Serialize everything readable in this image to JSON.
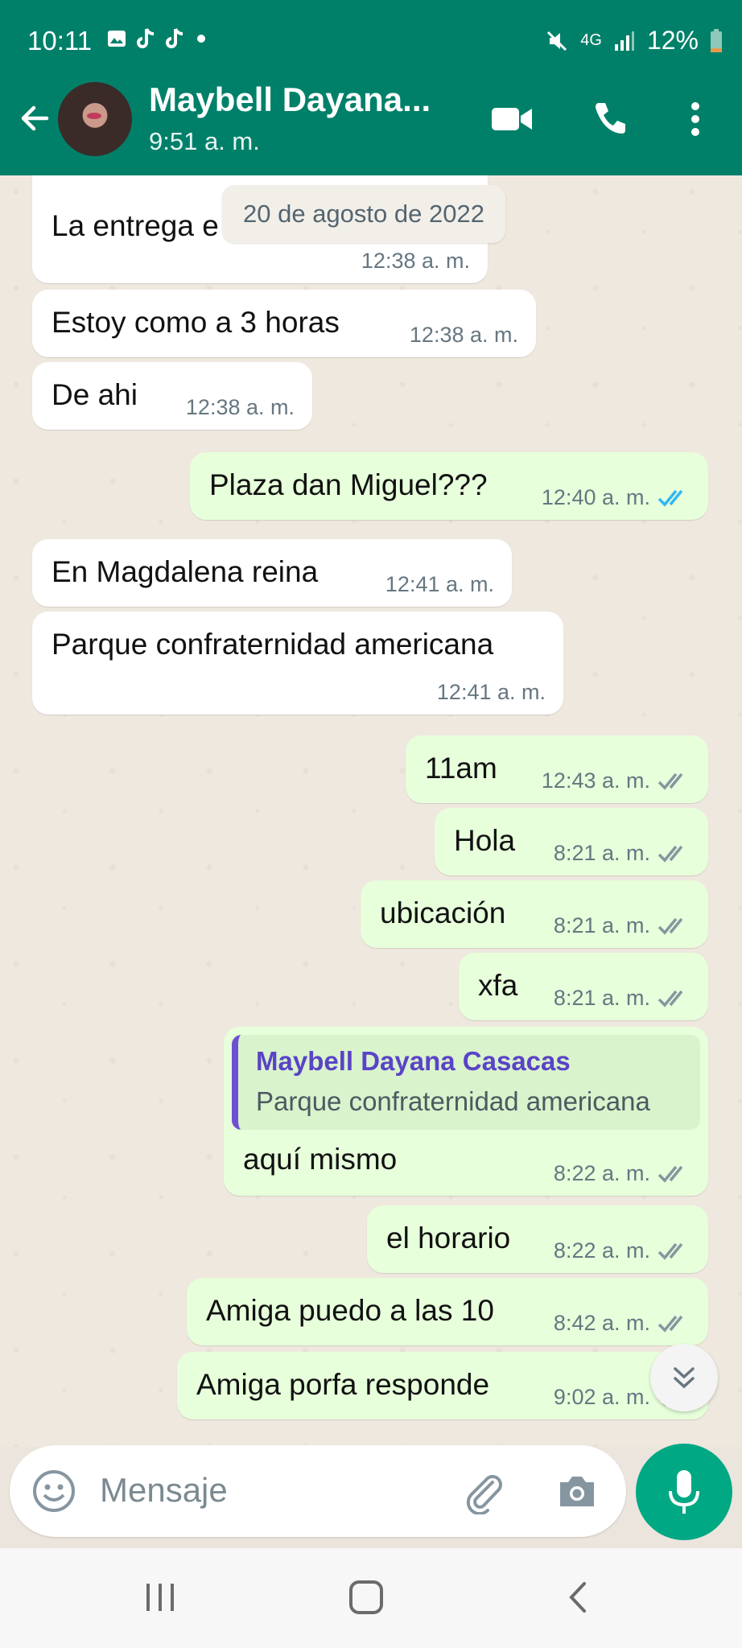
{
  "status_bar": {
    "time": "10:11",
    "battery": "12%",
    "network": "4G"
  },
  "header": {
    "name": "Maybell Dayana...",
    "last_seen": "9:51 a. m."
  },
  "date_chip": "20 de agosto de 2022",
  "messages": [
    {
      "dir": "in",
      "text": "La entrega e",
      "time": "12:38 a. m."
    },
    {
      "dir": "in",
      "text": "Estoy como a 3 horas",
      "time": "12:38 a. m."
    },
    {
      "dir": "in",
      "text": "De ahi",
      "time": "12:38 a. m."
    },
    {
      "dir": "out",
      "text": "Plaza dan Miguel???",
      "time": "12:40 a. m.",
      "status": "read"
    },
    {
      "dir": "in",
      "text": "En Magdalena reina",
      "time": "12:41 a. m."
    },
    {
      "dir": "in",
      "text": "Parque confraternidad americana",
      "time": "12:41 a. m."
    },
    {
      "dir": "out",
      "text": "11am",
      "time": "12:43 a. m.",
      "status": "delivered"
    },
    {
      "dir": "out",
      "text": "Hola",
      "time": "8:21 a. m.",
      "status": "delivered"
    },
    {
      "dir": "out",
      "text": "ubicación",
      "time": "8:21 a. m.",
      "status": "delivered"
    },
    {
      "dir": "out",
      "text": "xfa",
      "time": "8:21 a. m.",
      "status": "delivered"
    },
    {
      "dir": "out",
      "text": "aquí mismo",
      "time": "8:22 a. m.",
      "status": "delivered",
      "quote": {
        "name": "Maybell Dayana Casacas",
        "text": "Parque confraternidad americana"
      }
    },
    {
      "dir": "out",
      "text": "el horario",
      "time": "8:22 a. m.",
      "status": "delivered"
    },
    {
      "dir": "out",
      "text": "Amiga puedo a las 10",
      "time": "8:42 a. m.",
      "status": "delivered"
    },
    {
      "dir": "out",
      "text": "Amiga porfa responde",
      "time": "9:02 a. m.",
      "status": "delivered"
    }
  ],
  "composer": {
    "placeholder": "Mensaje"
  },
  "icons": {
    "back": "back-arrow-icon",
    "video": "video-call-icon",
    "call": "phone-icon",
    "menu": "more-vert-icon",
    "emoji": "emoji-icon",
    "attach": "attach-icon",
    "camera": "camera-icon",
    "mic": "mic-icon"
  },
  "colors": {
    "header": "#008069",
    "incoming": "#ffffff",
    "outgoing": "#e7ffdb",
    "read_tick": "#34b7f1",
    "accent": "#00a884"
  }
}
